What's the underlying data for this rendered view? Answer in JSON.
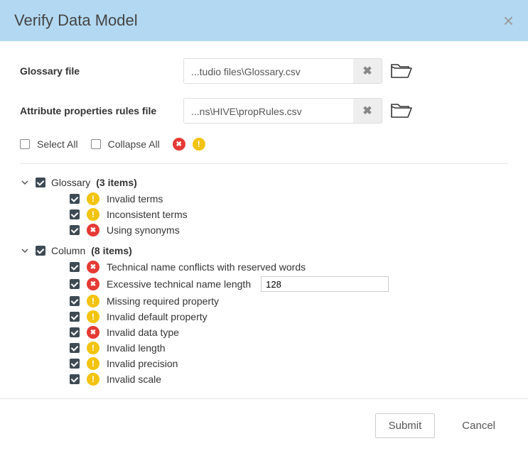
{
  "header": {
    "title": "Verify Data Model"
  },
  "files": {
    "glossary": {
      "label": "Glossary file",
      "value": "...tudio files\\Glossary.csv"
    },
    "rules": {
      "label": "Attribute properties rules file",
      "value": "...ns\\HIVE\\propRules.csv"
    }
  },
  "controls": {
    "select_all": {
      "label": "Select All",
      "checked": false
    },
    "collapse_all": {
      "label": "Collapse All",
      "checked": false
    }
  },
  "tree": {
    "groups": [
      {
        "label": "Glossary",
        "count_text": "(3 items)",
        "checked": true,
        "items": [
          {
            "checked": true,
            "status": "warn",
            "label": "Invalid terms"
          },
          {
            "checked": true,
            "status": "warn",
            "label": "Inconsistent terms"
          },
          {
            "checked": true,
            "status": "error",
            "label": "Using synonyms"
          }
        ]
      },
      {
        "label": "Column",
        "count_text": "(8 items)",
        "checked": true,
        "items": [
          {
            "checked": true,
            "status": "error",
            "label": "Technical name conflicts with reserved words"
          },
          {
            "checked": true,
            "status": "error",
            "label": "Excessive technical name length",
            "input_value": "128"
          },
          {
            "checked": true,
            "status": "warn",
            "label": "Missing required property"
          },
          {
            "checked": true,
            "status": "warn",
            "label": "Invalid default property"
          },
          {
            "checked": true,
            "status": "error",
            "label": "Invalid data type"
          },
          {
            "checked": true,
            "status": "warn",
            "label": "Invalid length"
          },
          {
            "checked": true,
            "status": "warn",
            "label": "Invalid precision"
          },
          {
            "checked": true,
            "status": "warn",
            "label": "Invalid scale"
          }
        ]
      }
    ]
  },
  "footer": {
    "submit": "Submit",
    "cancel": "Cancel"
  }
}
